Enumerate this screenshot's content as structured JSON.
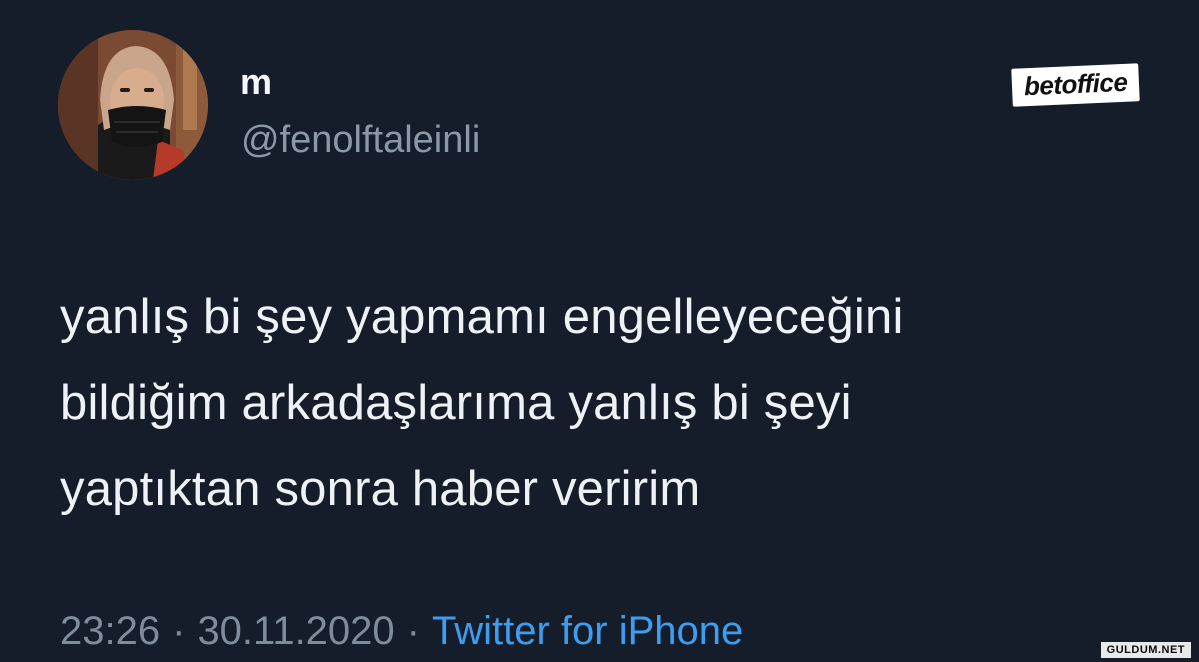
{
  "tweet": {
    "display_name": "m",
    "handle": "@fenolftaleinli",
    "lines": [
      "yanlış bi şey yapmamı engelleyeceğini",
      "bildiğim arkadaşlarıma yanlış bi şeyi",
      "yaptıktan sonra haber veririm"
    ],
    "time": "23:26",
    "separator": "·",
    "date": "30.11.2020",
    "source": "Twitter for iPhone"
  },
  "watermark": {
    "brand": "betoffice",
    "site": "GULDUM.NET"
  },
  "colors": {
    "background": "#151c2a",
    "text": "#eef2f6",
    "secondary": "#8a98a8",
    "link": "#3b9ef0"
  },
  "icons": {
    "avatar": "profile-photo"
  }
}
